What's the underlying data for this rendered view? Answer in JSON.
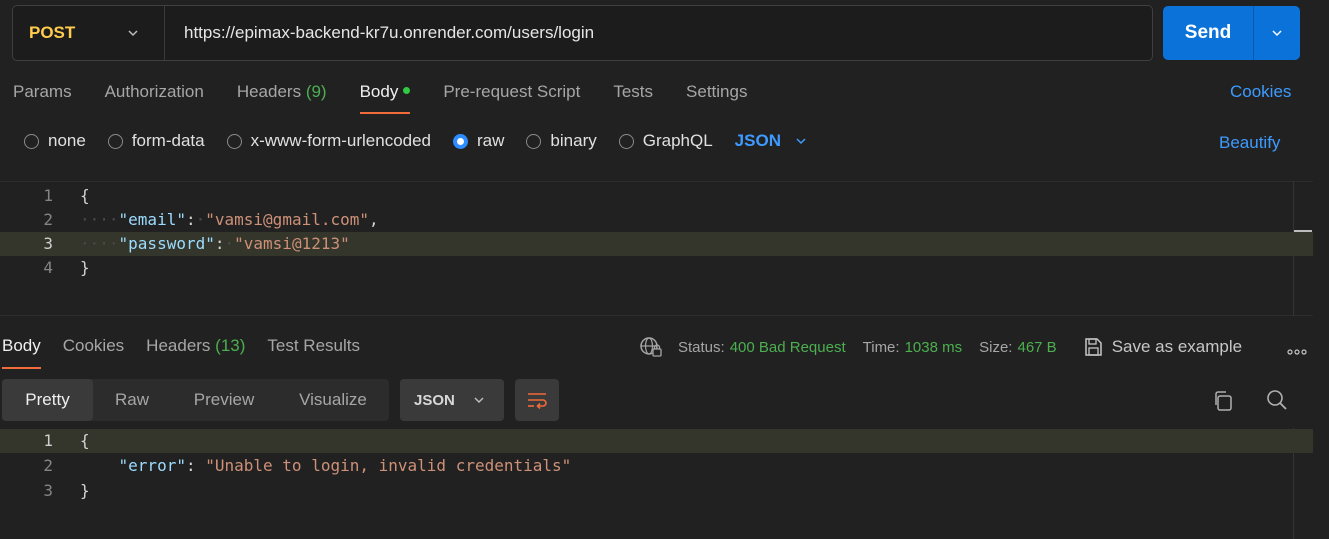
{
  "request": {
    "method": "POST",
    "url": "https://epimax-backend-kr7u.onrender.com/users/login",
    "send_label": "Send"
  },
  "request_tabs": {
    "params": "Params",
    "authorization": "Authorization",
    "headers": "Headers",
    "headers_count": "(9)",
    "body": "Body",
    "pre_request": "Pre-request Script",
    "tests": "Tests",
    "settings": "Settings",
    "cookies": "Cookies"
  },
  "body_types": {
    "none": "none",
    "form_data": "form-data",
    "urlencoded": "x-www-form-urlencoded",
    "raw": "raw",
    "binary": "binary",
    "graphql": "GraphQL",
    "selected": "raw",
    "language": "JSON",
    "beautify": "Beautify"
  },
  "request_body": {
    "line_numbers": [
      "1",
      "2",
      "3",
      "4"
    ],
    "open_brace": "{",
    "close_brace": "}",
    "email_key": "\"email\"",
    "email_value": "\"vamsi@gmail.com\"",
    "password_key": "\"password\"",
    "password_value": "\"vamsi@1213\""
  },
  "response_tabs": {
    "body": "Body",
    "cookies": "Cookies",
    "headers": "Headers",
    "headers_count": "(13)",
    "test_results": "Test Results"
  },
  "response_meta": {
    "status_label": "Status:",
    "status_value": "400 Bad Request",
    "time_label": "Time:",
    "time_value": "1038 ms",
    "size_label": "Size:",
    "size_value": "467 B",
    "save_example": "Save as example"
  },
  "response_view": {
    "pretty": "Pretty",
    "raw": "Raw",
    "preview": "Preview",
    "visualize": "Visualize",
    "format": "JSON"
  },
  "response_body": {
    "line_numbers": [
      "1",
      "2",
      "3"
    ],
    "open_brace": "{",
    "close_brace": "}",
    "error_key": "\"error\"",
    "error_value": "\"Unable to login, invalid credentials\""
  },
  "colors": {
    "accent_blue": "#0b72d9",
    "method_yellow": "#ffcc4d",
    "status_green": "#4caf50",
    "tab_underline": "#f26b3a"
  }
}
